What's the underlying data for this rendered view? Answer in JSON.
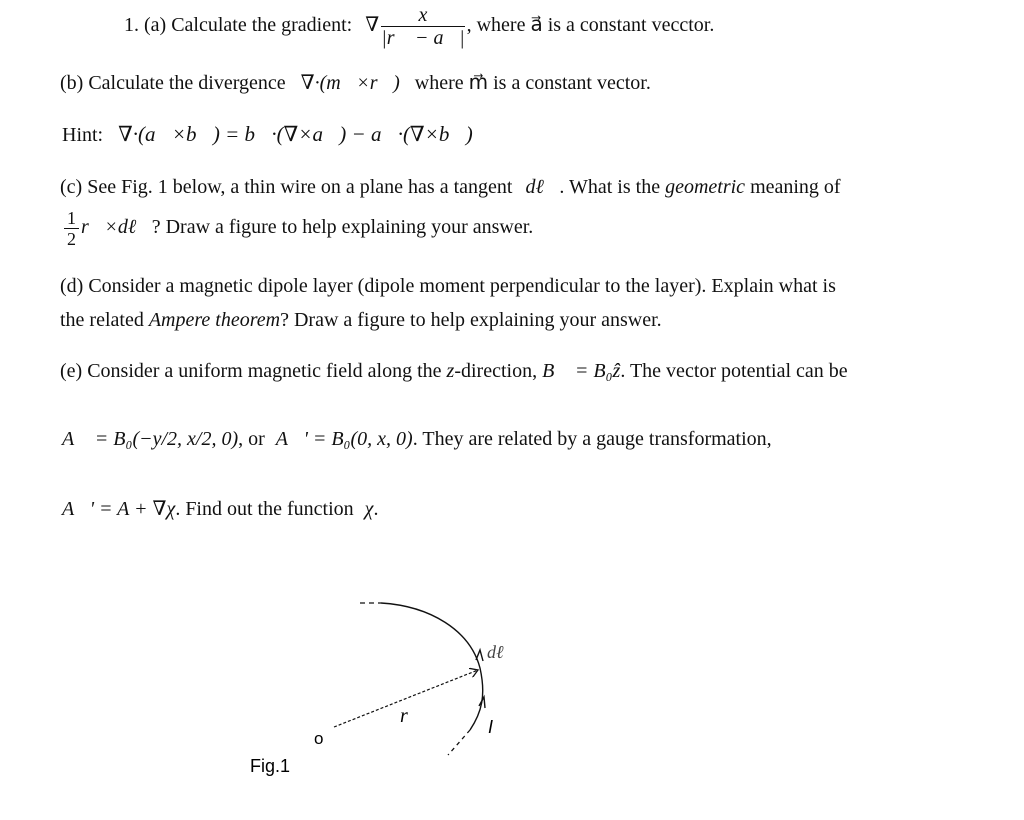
{
  "problem": {
    "a": {
      "prefix": "1. (a) Calculate the gradient:",
      "nabla": "∇",
      "numerator": "x",
      "denominator": "|r⃗ − a⃗|",
      "suffix": ", where  a⃗  is a constant vecctor."
    },
    "b": {
      "text": "(b) Calculate the divergence",
      "expr": "∇·(m⃗×r⃗)",
      "suffix": "where  m⃗  is a constant vector."
    },
    "hint": {
      "label": "Hint:",
      "expr": "∇·(a⃗×b⃗) = b⃗·(∇×a⃗) − a⃗·(∇×b⃗)"
    },
    "c": {
      "line1_pre": "(c) See Fig. 1 below, a thin wire on a plane has a tangent",
      "line1_dl": "dℓ⃗",
      "line1_mid": ". What is the",
      "line1_em": "geometric",
      "line1_post": "meaning of",
      "frac_num": "1",
      "frac_den": "2",
      "line2_expr": "r⃗×dℓ⃗",
      "line2_post": "? Draw a figure to help explaining your answer."
    },
    "d": {
      "line1": "(d) Consider a magnetic dipole layer (dipole moment perpendicular to the layer). Explain what is",
      "line2_pre": "the related",
      "line2_em": "Ampere theorem",
      "line2_post": "? Draw a figure to help explaining your answer."
    },
    "e": {
      "line1_pre": "(e) Consider a uniform magnetic field along the",
      "line1_z": "z",
      "line1_mid": "-direction,",
      "line1_expr": "B⃗ = B₀ẑ",
      "line1_post": ". The vector potential can be",
      "line2_expr1": "A⃗ = B₀(−y/2, x/2, 0)",
      "line2_or": ", or",
      "line2_expr2": "A⃗' = B₀(0, x, 0)",
      "line2_post": ". They are related by a gauge transformation,",
      "line3_expr": "A⃗' = A + ∇χ",
      "line3_post": ". Find out the function",
      "line3_chi": "χ",
      "line3_end": "."
    }
  },
  "figure": {
    "caption": "Fig.1",
    "origin_label": "o",
    "r_label": "r⃗",
    "dl_label": "dℓ⃗",
    "current_label": "I"
  }
}
